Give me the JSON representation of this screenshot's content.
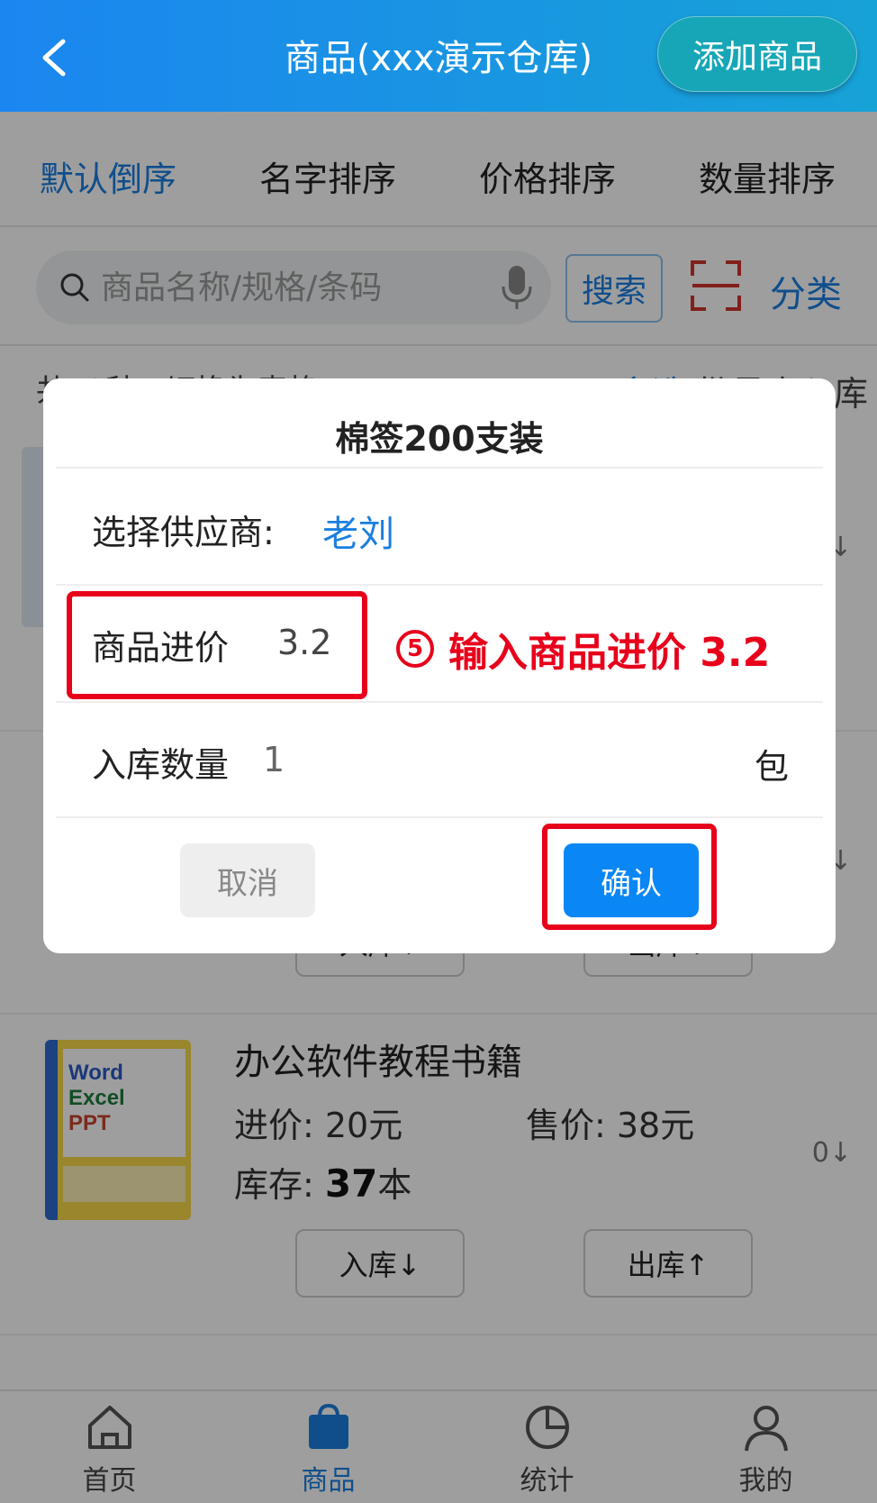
{
  "header": {
    "title": "商品(xxx演示仓库)",
    "add_button": "添加商品"
  },
  "sort": {
    "items": [
      "默认倒序",
      "名字排序",
      "价格排序",
      "数量排序"
    ]
  },
  "search": {
    "placeholder": "商品名称/规格/条码",
    "button": "搜索",
    "category": "分类"
  },
  "summary": {
    "left": "共72种 · 切换为表格",
    "multi": "多选",
    "right": "批量出入库"
  },
  "products": [
    {
      "name": "办公软件教程书籍",
      "cost": "进价: 20元",
      "price": "售价: 38元",
      "stock_label": "库存:",
      "stock_value": "37",
      "stock_unit": "本",
      "qty": "0↓"
    }
  ],
  "row_buttons": {
    "in": "入库↓",
    "out": "出库↑"
  },
  "side_qty": [
    "↓",
    "↓"
  ],
  "dialog": {
    "title": "棉签200支装",
    "supplier_label": "选择供应商:",
    "supplier_value": "老刘",
    "cost_label": "商品进价",
    "cost_value": "3.2",
    "qty_label": "入库数量",
    "qty_value": "1",
    "unit": "包",
    "cancel": "取消",
    "confirm": "确认"
  },
  "annotation": {
    "step": "5",
    "text": "输入商品进价 3.2"
  },
  "tabbar": {
    "items": [
      "首页",
      "商品",
      "统计",
      "我的"
    ],
    "active_index": 1
  },
  "colors": {
    "accent": "#1a7fe0",
    "annotation": "#e8001b",
    "confirm": "#0a86f5"
  },
  "icons": {
    "back": "chevron-left-icon",
    "search": "search-icon",
    "mic": "mic-icon",
    "scan": "scan-icon"
  }
}
